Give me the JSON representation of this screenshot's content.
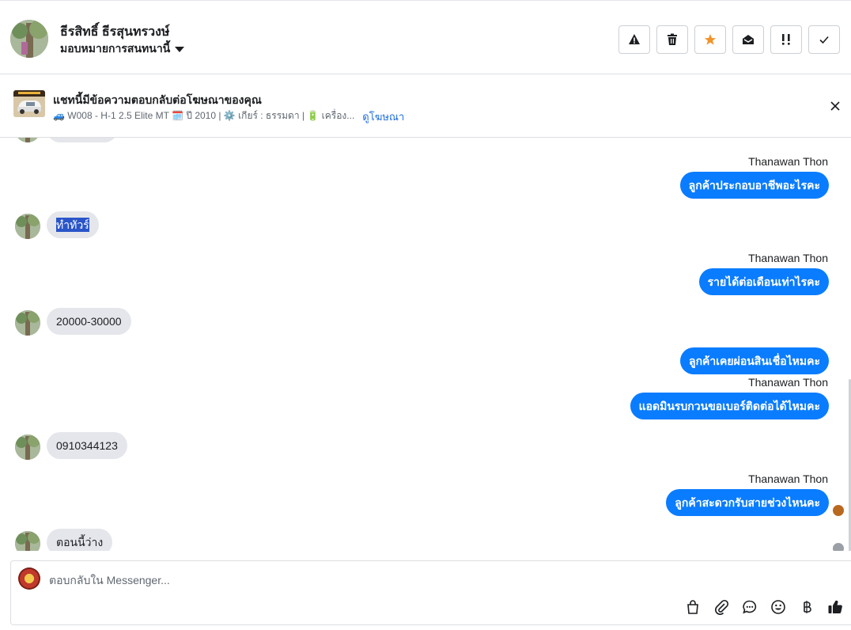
{
  "header": {
    "contact_name": "ธีรสิทธิ์ ธีรสุนทรวงษ์",
    "assign_label": "มอบหมายการสนทนานี้",
    "actions": [
      {
        "name": "report-spam-button",
        "icon": "warning-icon"
      },
      {
        "name": "delete-button",
        "icon": "trash-icon"
      },
      {
        "name": "star-button",
        "icon": "star-icon"
      },
      {
        "name": "mark-unread-button",
        "icon": "envelope-open-icon"
      },
      {
        "name": "follow-up-button",
        "icon": "exclamation-icon"
      },
      {
        "name": "done-button",
        "icon": "check-icon"
      }
    ],
    "star_color": "#f0932b"
  },
  "ad": {
    "title": "แชทนี้มีข้อความตอบกลับต่อโฆษณาของคุณ",
    "description": "🚙 W008 - H-1 2.5 Elite MT 🗓️ ปี 2010 | ⚙️ เกียร์ : ธรรมดา | 🔋 เครื่อง...",
    "view_ad_label": "ดูโฆษณา"
  },
  "messages": [
    {
      "direction": "out",
      "sender": "Thanawan Thon",
      "text": "ลูกค้าประกอบอาชีพอะไรคะ"
    },
    {
      "direction": "in",
      "text": "ทำทัวร์",
      "selected": true
    },
    {
      "direction": "out",
      "sender": "Thanawan Thon",
      "text": "รายได้ต่อเดือนเท่าไรคะ"
    },
    {
      "direction": "in",
      "text": "20000-30000"
    },
    {
      "direction": "out",
      "text": "ลูกค้าเคยผ่อนสินเชื่อไหมคะ"
    },
    {
      "direction": "out",
      "sender": "Thanawan Thon",
      "text": "แอดมินรบกวนขอเบอร์ติดต่อได้ไหมคะ"
    },
    {
      "direction": "in",
      "text": "0910344123"
    },
    {
      "direction": "out",
      "sender": "Thanawan Thon",
      "text": "ลูกค้าสะดวกรับสายช่วงไหนคะ"
    },
    {
      "direction": "in",
      "text": "ตอนนี้ว่าง"
    }
  ],
  "composer": {
    "placeholder": "ตอบกลับใน Messenger...",
    "tools": [
      "shopping-bag-icon",
      "paperclip-icon",
      "chat-bubble-icon",
      "emoji-icon",
      "baht-icon",
      "thumbs-up-icon"
    ]
  },
  "colors": {
    "outgoing_bubble": "#0a7cff",
    "incoming_bubble": "#e4e6eb",
    "link": "#216fdb"
  }
}
